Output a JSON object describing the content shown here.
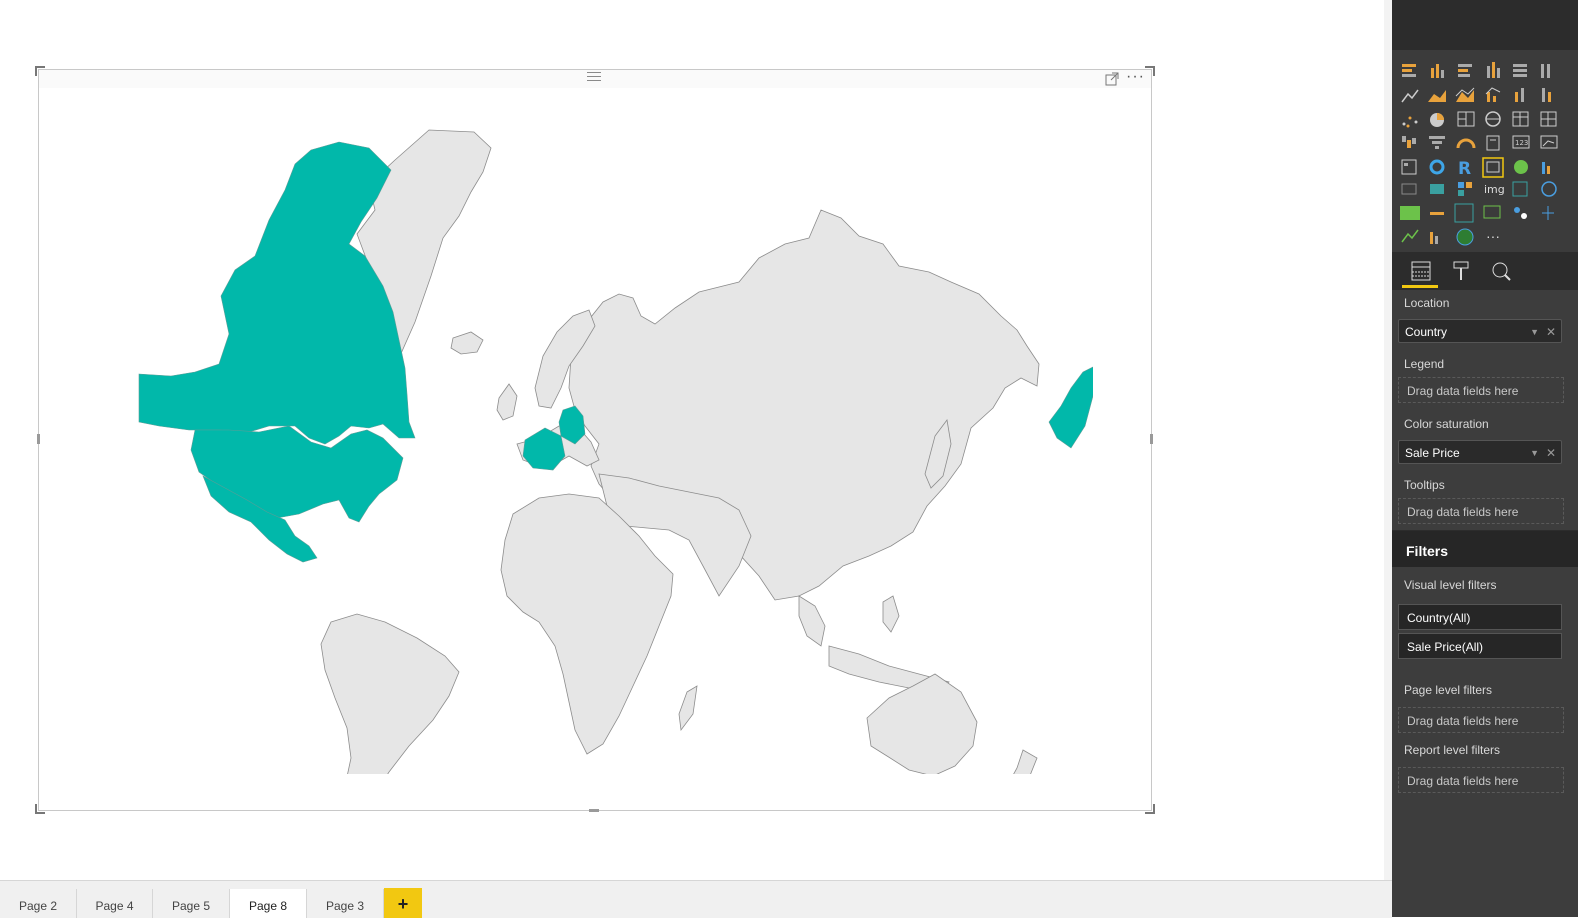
{
  "map": {
    "highlight_color": "#01b8aa",
    "land_color": "#e6e6e6",
    "border_color": "#8c8c8c",
    "highlighted_countries": [
      "Canada",
      "United States",
      "Mexico",
      "France",
      "Germany"
    ]
  },
  "visual_header": {
    "more_label": "···"
  },
  "tabs": [
    {
      "label": "Page 2",
      "active": false
    },
    {
      "label": "Page 4",
      "active": false
    },
    {
      "label": "Page 5",
      "active": false
    },
    {
      "label": "Page 8",
      "active": true
    },
    {
      "label": "Page 3",
      "active": false
    }
  ],
  "add_page_label": "+",
  "panel": {
    "location_label": "Location",
    "location_field": "Country",
    "legend_label": "Legend",
    "legend_placeholder": "Drag data fields here",
    "color_saturation_label": "Color saturation",
    "color_saturation_field": "Sale Price",
    "tooltips_label": "Tooltips",
    "tooltips_placeholder": "Drag data fields here",
    "filters_title": "Filters",
    "visual_filters_label": "Visual level filters",
    "visual_filters": [
      "Country(All)",
      "Sale Price(All)"
    ],
    "page_filters_label": "Page level filters",
    "page_filters_placeholder": "Drag data fields here",
    "report_filters_label": "Report level filters",
    "report_filters_placeholder": "Drag data fields here",
    "viz_more_label": "···",
    "viz_img_label": "img",
    "viz_r_label": "R",
    "viz_123_label": "123"
  }
}
